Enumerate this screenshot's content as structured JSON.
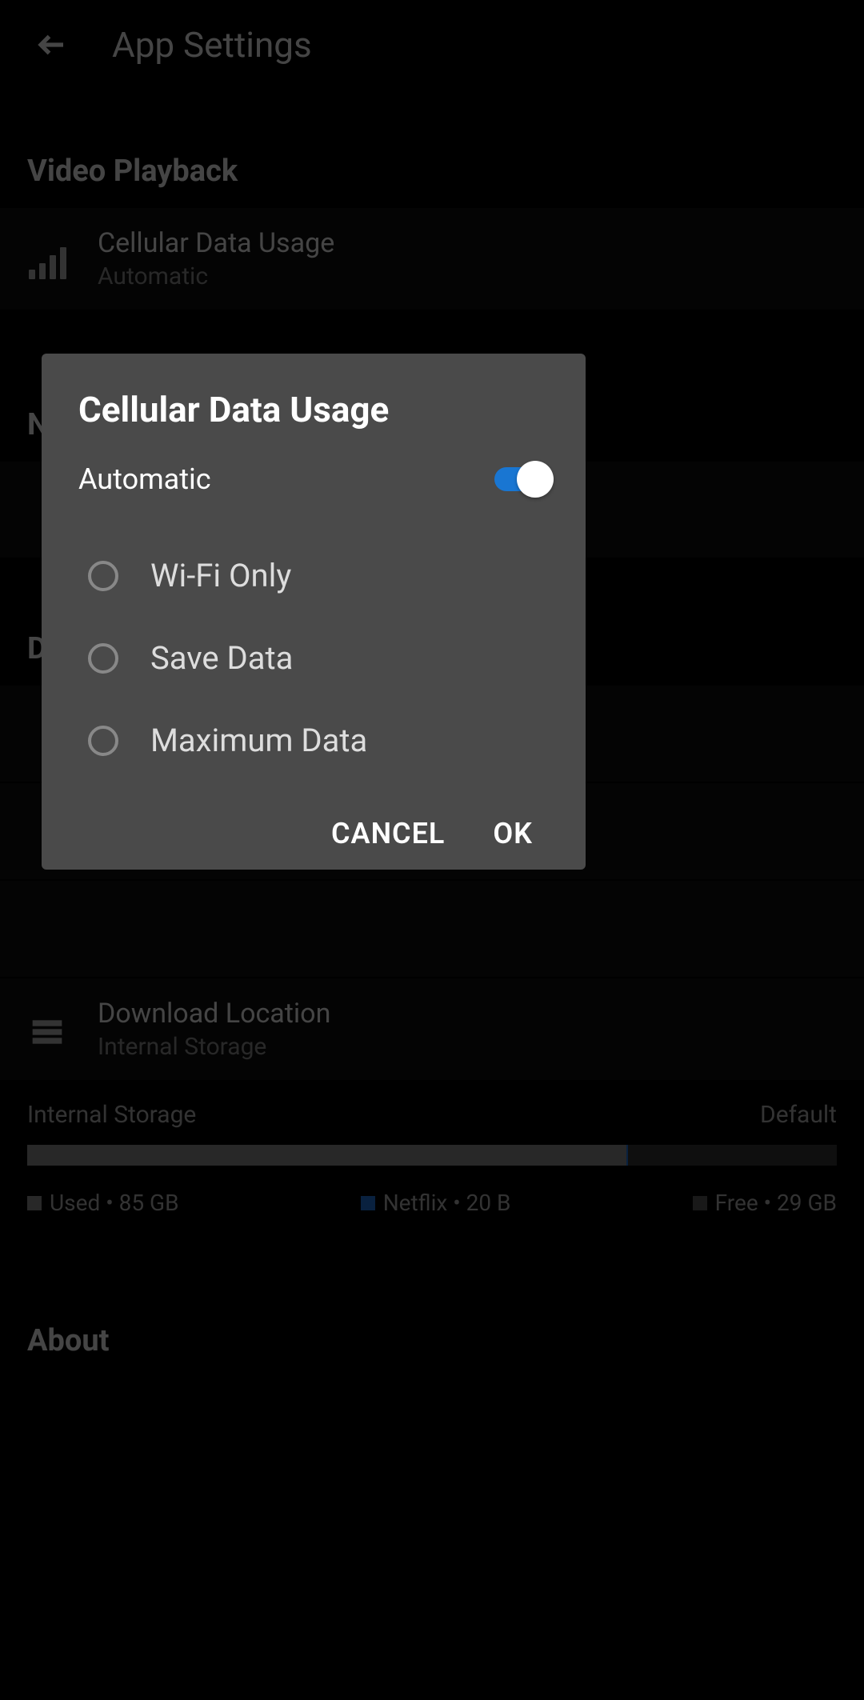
{
  "header": {
    "title": "App Settings"
  },
  "sections": {
    "video_playback": {
      "title": "Video Playback",
      "cellular": {
        "label": "Cellular Data Usage",
        "value": "Automatic"
      }
    },
    "notifications_title_partial": "N",
    "downloads_title_partial": "D",
    "download_location": {
      "label": "Download Location",
      "value": "Internal Storage"
    },
    "storage": {
      "name": "Internal Storage",
      "default_label": "Default",
      "used": {
        "label": "Used",
        "value": "85 GB",
        "color": "#888888",
        "percent": 74
      },
      "netflix": {
        "label": "Netflix",
        "value": "20 B",
        "color": "#1f6fd4",
        "percent": 0.2
      },
      "free": {
        "label": "Free",
        "value": "29 GB",
        "color": "#555555"
      }
    },
    "about_title": "About"
  },
  "dialog": {
    "title": "Cellular Data Usage",
    "automatic_label": "Automatic",
    "automatic_on": true,
    "options": [
      {
        "label": "Wi-Fi Only",
        "selected": false
      },
      {
        "label": "Save Data",
        "selected": false
      },
      {
        "label": "Maximum Data",
        "selected": false
      }
    ],
    "cancel_label": "CANCEL",
    "ok_label": "OK"
  }
}
